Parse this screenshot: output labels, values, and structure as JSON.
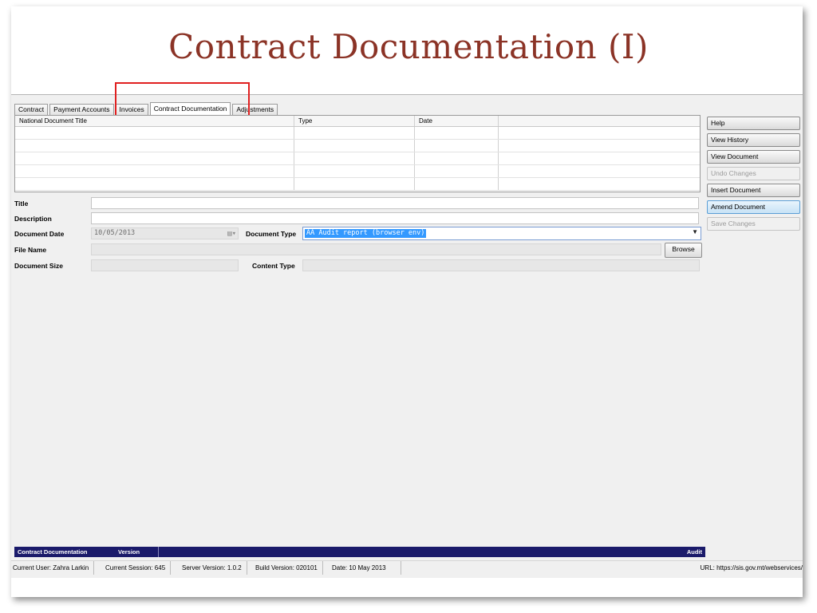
{
  "slide": {
    "title": "Contract Documentation (I)"
  },
  "tabs": [
    {
      "label": "Contract"
    },
    {
      "label": "Payment Accounts"
    },
    {
      "label": "Invoices"
    },
    {
      "label": "Contract Documentation",
      "active": true
    },
    {
      "label": "Adjustments"
    }
  ],
  "grid": {
    "columns": [
      "National Document Title",
      "Type",
      "Date",
      ""
    ],
    "rows": []
  },
  "form": {
    "title_label": "Title",
    "title_value": "",
    "description_label": "Description",
    "description_value": "",
    "document_date_label": "Document Date",
    "document_date_value": "10/05/2013",
    "document_type_label": "Document Type",
    "document_type_value": "AA Audit report (browser env)",
    "file_name_label": "File Name",
    "file_name_value": "",
    "browse_label": "Browse",
    "document_size_label": "Document Size",
    "document_size_value": "",
    "content_type_label": "Content Type",
    "content_type_value": ""
  },
  "side_buttons": [
    {
      "label": "Help",
      "state": "enabled"
    },
    {
      "label": "View History",
      "state": "enabled"
    },
    {
      "label": "View Document",
      "state": "enabled"
    },
    {
      "label": "Undo Changes",
      "state": "disabled"
    },
    {
      "label": "Insert Document",
      "state": "enabled"
    },
    {
      "label": "Amend Document",
      "state": "active"
    },
    {
      "label": "Save Changes",
      "state": "disabled"
    }
  ],
  "status_bar": {
    "module": "Contract Documentation",
    "version": "Version",
    "audit": "Audit"
  },
  "info_bar": {
    "user": "Current User: Zahra Larkin",
    "session": "Current Session: 645",
    "server_version": "Server Version: 1.0.2",
    "build_version": "Build Version: 020101",
    "date": "Date: 10 May 2013",
    "url": "URL: https://sis.gov.mt/webservices/"
  },
  "colors": {
    "title": "#8b3326",
    "highlight": "#e02020",
    "status_bar": "#1a1a6a",
    "selection": "#3399ff"
  }
}
